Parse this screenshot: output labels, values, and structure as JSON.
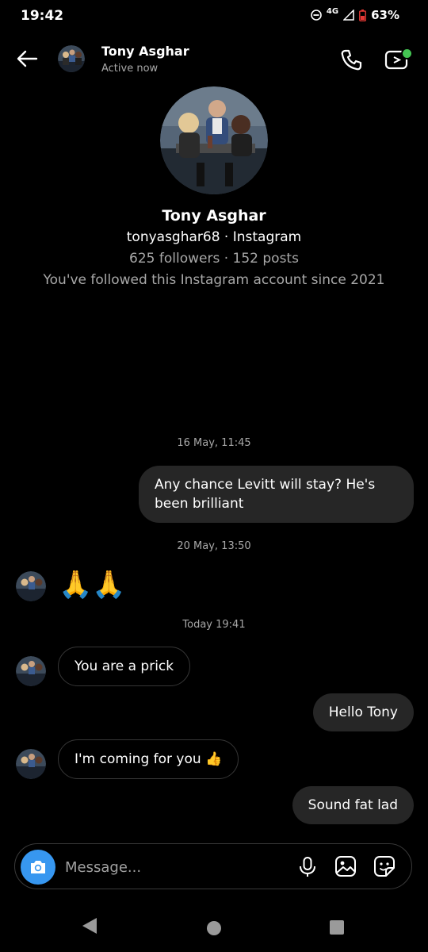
{
  "status_bar": {
    "time": "19:42",
    "network": "4G",
    "battery": "63%"
  },
  "header": {
    "name": "Tony Asghar",
    "status": "Active now"
  },
  "profile": {
    "name": "Tony Asghar",
    "handle_line": "tonyasghar68 · Instagram",
    "stats_line": "625 followers · 152 posts",
    "follow_line": "You've followed this Instagram account since 2021"
  },
  "messages": {
    "ts1": "16 May, 11:45",
    "m1": "Any chance Levitt will stay? He's been brilliant",
    "ts2": "20 May, 13:50",
    "m2": "🙏🙏",
    "ts3": "Today 19:41",
    "m3": "You are a prick",
    "m4": "Hello Tony",
    "m5": "I'm coming for you 👍",
    "m6": "Sound fat lad"
  },
  "composer": {
    "placeholder": "Message..."
  },
  "colors": {
    "accent": "#3797f0",
    "bubble_out": "#262626",
    "online": "#44c553"
  }
}
